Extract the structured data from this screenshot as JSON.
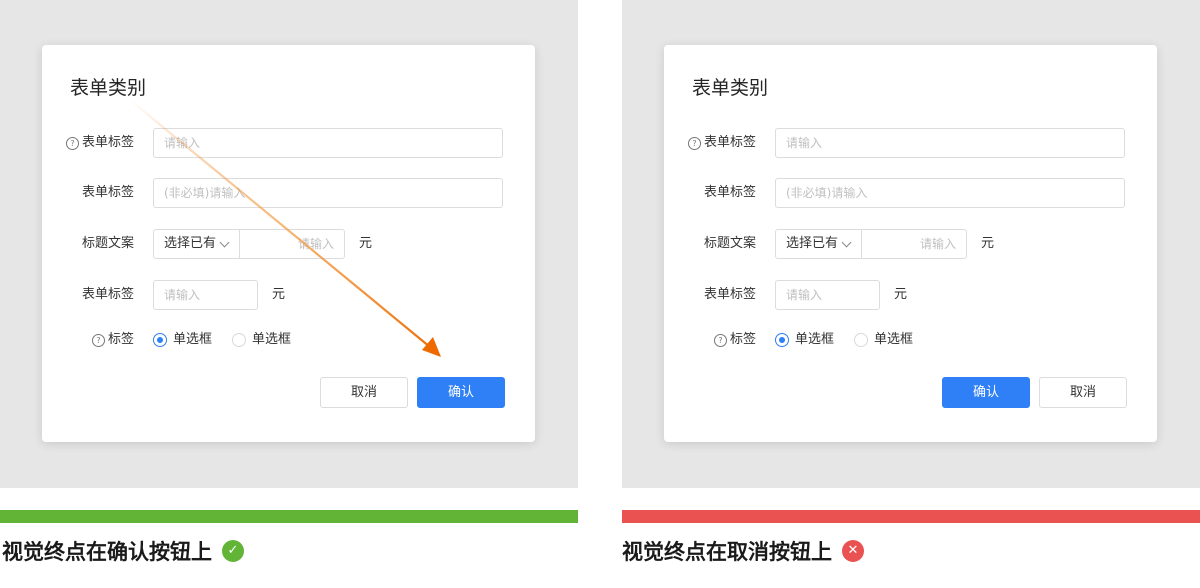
{
  "colors": {
    "primary": "#2f7ff6",
    "good": "#62b436",
    "bad": "#ea5252",
    "arrow": "#ee6a00"
  },
  "left_example": {
    "dialog": {
      "title": "表单类别",
      "rows": [
        {
          "label": "表单标签",
          "has_help": true,
          "placeholder": "请输入"
        },
        {
          "label": "表单标签",
          "has_help": false,
          "placeholder": "(非必填)请输入"
        },
        {
          "label": "标题文案",
          "select_value": "选择已有",
          "placeholder": "请输入",
          "unit": "元"
        },
        {
          "label": "表单标签",
          "placeholder": "请输入",
          "unit": "元"
        },
        {
          "label": "标签",
          "has_help": true,
          "radios": [
            {
              "label": "单选框",
              "checked": true
            },
            {
              "label": "单选框",
              "checked": false
            }
          ]
        }
      ],
      "buttons": {
        "cancel": "取消",
        "confirm": "确认"
      }
    },
    "caption": "视觉终点在确认按钮上",
    "status_icon": "check-icon"
  },
  "right_example": {
    "dialog": {
      "title": "表单类别",
      "rows": [
        {
          "label": "表单标签",
          "has_help": true,
          "placeholder": "请输入"
        },
        {
          "label": "表单标签",
          "has_help": false,
          "placeholder": "(非必填)请输入"
        },
        {
          "label": "标题文案",
          "select_value": "选择已有",
          "placeholder": "请输入",
          "unit": "元"
        },
        {
          "label": "表单标签",
          "placeholder": "请输入",
          "unit": "元"
        },
        {
          "label": "标签",
          "has_help": true,
          "radios": [
            {
              "label": "单选框",
              "checked": true
            },
            {
              "label": "单选框",
              "checked": false
            }
          ]
        }
      ],
      "buttons": {
        "confirm": "确认",
        "cancel": "取消"
      }
    },
    "caption": "视觉终点在取消按钮上",
    "status_icon": "close-icon"
  }
}
